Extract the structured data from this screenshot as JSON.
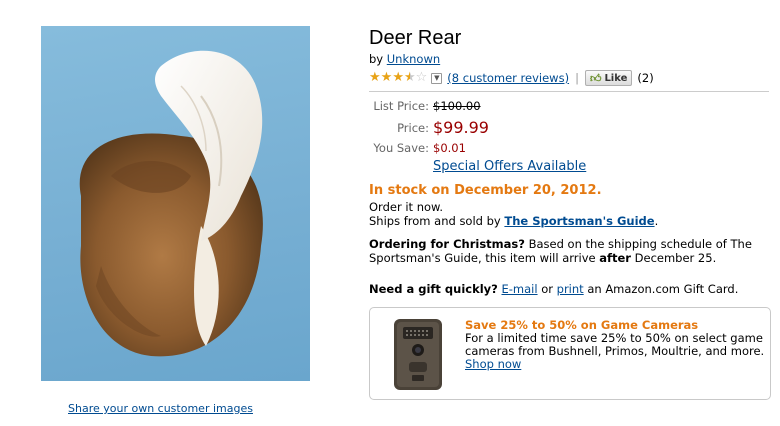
{
  "product": {
    "title": "Deer Rear",
    "by_prefix": "by",
    "author": "Unknown"
  },
  "rating": {
    "stars": 3.5,
    "reviews_link": "(8 customer reviews)",
    "separator": "|",
    "like_label": "Like",
    "like_count": "(2)"
  },
  "pricing": {
    "list_label": "List Price:",
    "list_value": "$100.00",
    "price_label": "Price:",
    "price_value": "$99.99",
    "save_label": "You Save:",
    "save_value": "$0.01",
    "offers_link": "Special Offers Available"
  },
  "availability": {
    "stock": "In stock on December 20, 2012.",
    "order_now": "Order it now.",
    "ships_prefix": "Ships from and sold by",
    "seller": "The Sportsman's Guide",
    "ships_suffix": "."
  },
  "christmas": {
    "heading": "Ordering for Christmas?",
    "text1": "Based on the shipping schedule of The Sportsman's Guide, this item will arrive",
    "emphasis": "after",
    "text2": "December 25."
  },
  "gift": {
    "heading": "Need a gift quickly?",
    "email_link": "E-mail",
    "or": "or",
    "print_link": "print",
    "suffix": "an Amazon.com Gift Card."
  },
  "promo": {
    "title": "Save 25% to 50% on Game Cameras",
    "text": "For a limited time save 25% to 50% on select game cameras from Bushnell, Primos, Moultrie, and more.",
    "link": "Shop now"
  },
  "images": {
    "share_link": "Share your own customer images"
  },
  "colors": {
    "link": "#004b91",
    "price": "#990000",
    "stock": "#e47911",
    "image_bg": "#7bb4d6"
  }
}
